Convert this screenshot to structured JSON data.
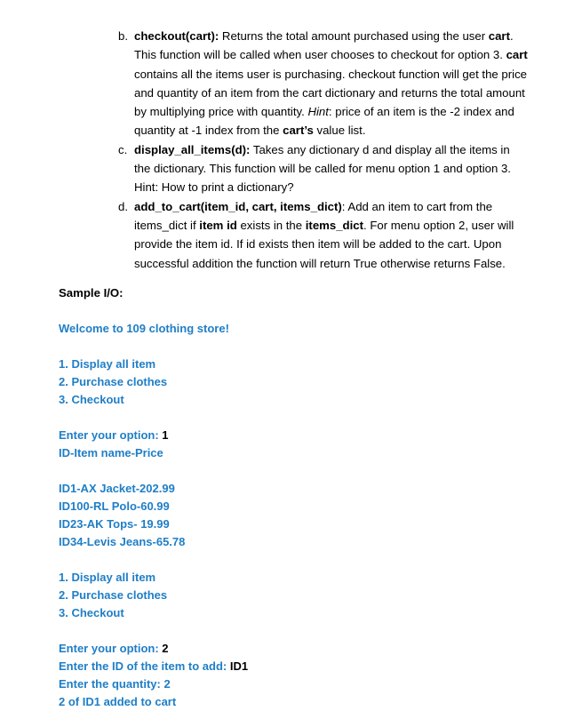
{
  "document": {
    "accent_color": "#1f7ec6",
    "text_color": "#000000",
    "list_items": [
      {
        "marker": "b.",
        "segments": [
          {
            "text": "checkout(cart):",
            "style": "bold"
          },
          {
            "text": " Returns the total amount purchased using the user ",
            "style": "normal"
          },
          {
            "text": "cart",
            "style": "bold"
          },
          {
            "text": ". This function will be called when user chooses to checkout for option 3. ",
            "style": "normal"
          },
          {
            "text": "cart",
            "style": "bold"
          },
          {
            "text": " contains all the items user is purchasing. checkout function will get the price and quantity of an item from the cart dictionary and returns the total amount by multiplying price with quantity. ",
            "style": "normal"
          },
          {
            "text": "Hint",
            "style": "italic"
          },
          {
            "text": ": price of an item is the -2 index and quantity at -1 index from the ",
            "style": "normal"
          },
          {
            "text": "cart’s",
            "style": "bold"
          },
          {
            "text": " value list.",
            "style": "normal"
          }
        ]
      },
      {
        "marker": "c.",
        "segments": [
          {
            "text": "display_all_items(d):",
            "style": "bold"
          },
          {
            "text": " Takes any dictionary d and display all the items in the dictionary. This function will be called for menu option 1 and option 3. Hint: How to print a dictionary?",
            "style": "normal"
          }
        ]
      },
      {
        "marker": "d.",
        "segments": [
          {
            "text": "add_to_cart(item_id, cart, items_dict)",
            "style": "bold"
          },
          {
            "text": ": Add an item to cart from the items_dict if ",
            "style": "normal"
          },
          {
            "text": "item id",
            "style": "bold"
          },
          {
            "text": " exists in the ",
            "style": "normal"
          },
          {
            "text": "items_dict",
            "style": "bold"
          },
          {
            "text": ". For menu option 2, user will provide the item id. If id exists then item will be added to the cart. Upon successful addition the function will return True  otherwise returns False.",
            "style": "normal"
          }
        ]
      }
    ],
    "sample_heading": "Sample I/O:",
    "sample_io": [
      {
        "kind": "gap"
      },
      {
        "kind": "line",
        "prompt": "Welcome to 109 clothing store!",
        "answer": ""
      },
      {
        "kind": "gap"
      },
      {
        "kind": "line",
        "prompt": "1. Display all item",
        "answer": ""
      },
      {
        "kind": "line",
        "prompt": "2. Purchase clothes",
        "answer": ""
      },
      {
        "kind": "line",
        "prompt": "3. Checkout",
        "answer": ""
      },
      {
        "kind": "gap"
      },
      {
        "kind": "line",
        "prompt": "Enter your option: ",
        "answer": "1"
      },
      {
        "kind": "line",
        "prompt": "ID-Item name-Price",
        "answer": ""
      },
      {
        "kind": "gap"
      },
      {
        "kind": "line",
        "prompt": "ID1-AX Jacket-202.99",
        "answer": ""
      },
      {
        "kind": "line",
        "prompt": "ID100-RL Polo-60.99",
        "answer": ""
      },
      {
        "kind": "line",
        "prompt": "ID23-AK Tops- 19.99",
        "answer": ""
      },
      {
        "kind": "line",
        "prompt": "ID34-Levis Jeans-65.78",
        "answer": ""
      },
      {
        "kind": "gap"
      },
      {
        "kind": "line",
        "prompt": "1. Display all item",
        "answer": ""
      },
      {
        "kind": "line",
        "prompt": "2. Purchase clothes",
        "answer": ""
      },
      {
        "kind": "line",
        "prompt": "3. Checkout",
        "answer": ""
      },
      {
        "kind": "gap"
      },
      {
        "kind": "line",
        "prompt": "Enter your option: ",
        "answer": "2"
      },
      {
        "kind": "line",
        "prompt": "Enter the ID of the item to add: ",
        "answer": "ID1"
      },
      {
        "kind": "line",
        "prompt": "Enter the quantity: 2",
        "answer": ""
      },
      {
        "kind": "line",
        "prompt": "2 of ID1 added to cart",
        "answer": ""
      }
    ]
  }
}
